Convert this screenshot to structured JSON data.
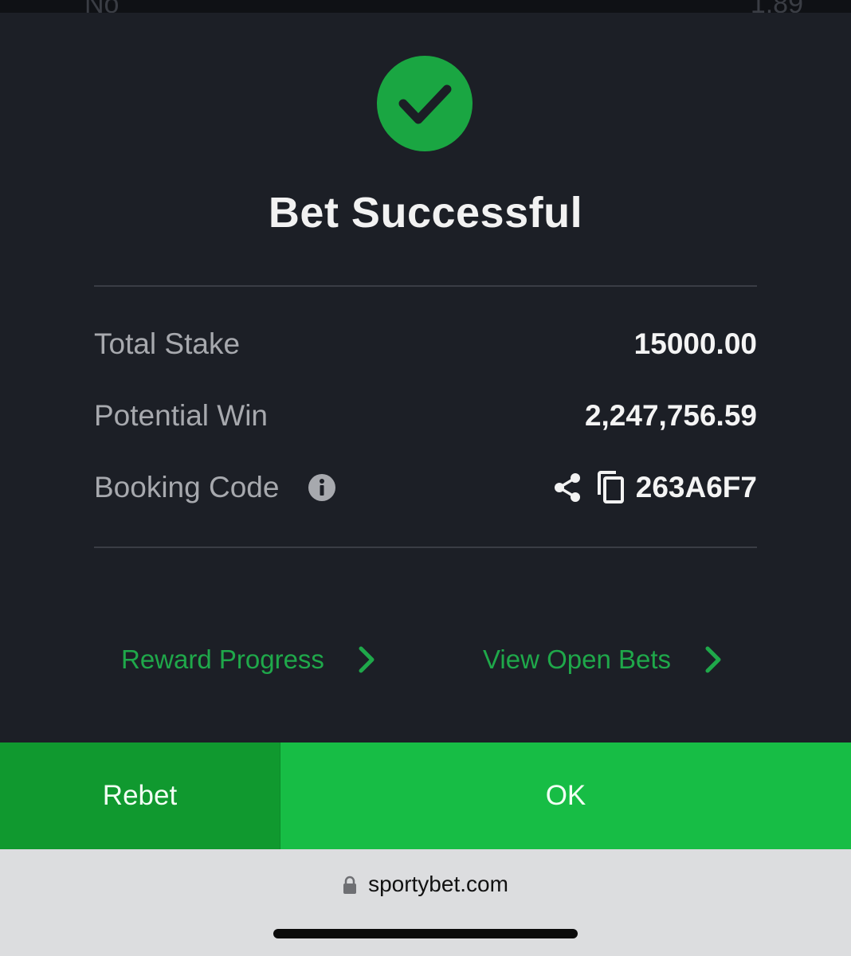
{
  "background": {
    "ghost_left_text": "No",
    "ghost_right_text": "1.89"
  },
  "dialog": {
    "status_icon": "checkmark-icon",
    "title": "Bet Successful",
    "rows": {
      "total_stake": {
        "label": "Total Stake",
        "value": "15000.00"
      },
      "potential_win": {
        "label": "Potential Win",
        "value": "2,247,756.59"
      },
      "booking_code": {
        "label": "Booking Code",
        "info_icon": "info-icon",
        "share_icon": "share-icon",
        "copy_icon": "copy-icon",
        "value": "263A6F7"
      }
    },
    "links": {
      "reward_progress": "Reward Progress",
      "view_open_bets": "View Open Bets"
    }
  },
  "buttons": {
    "rebet": "Rebet",
    "ok": "OK"
  },
  "browser": {
    "lock_icon": "lock-icon",
    "url": "sportybet.com"
  },
  "colors": {
    "accent_green": "#17bd45",
    "dark_green": "#10992f",
    "link_green": "#1fa84a",
    "dialog_bg": "#1c1f26"
  }
}
